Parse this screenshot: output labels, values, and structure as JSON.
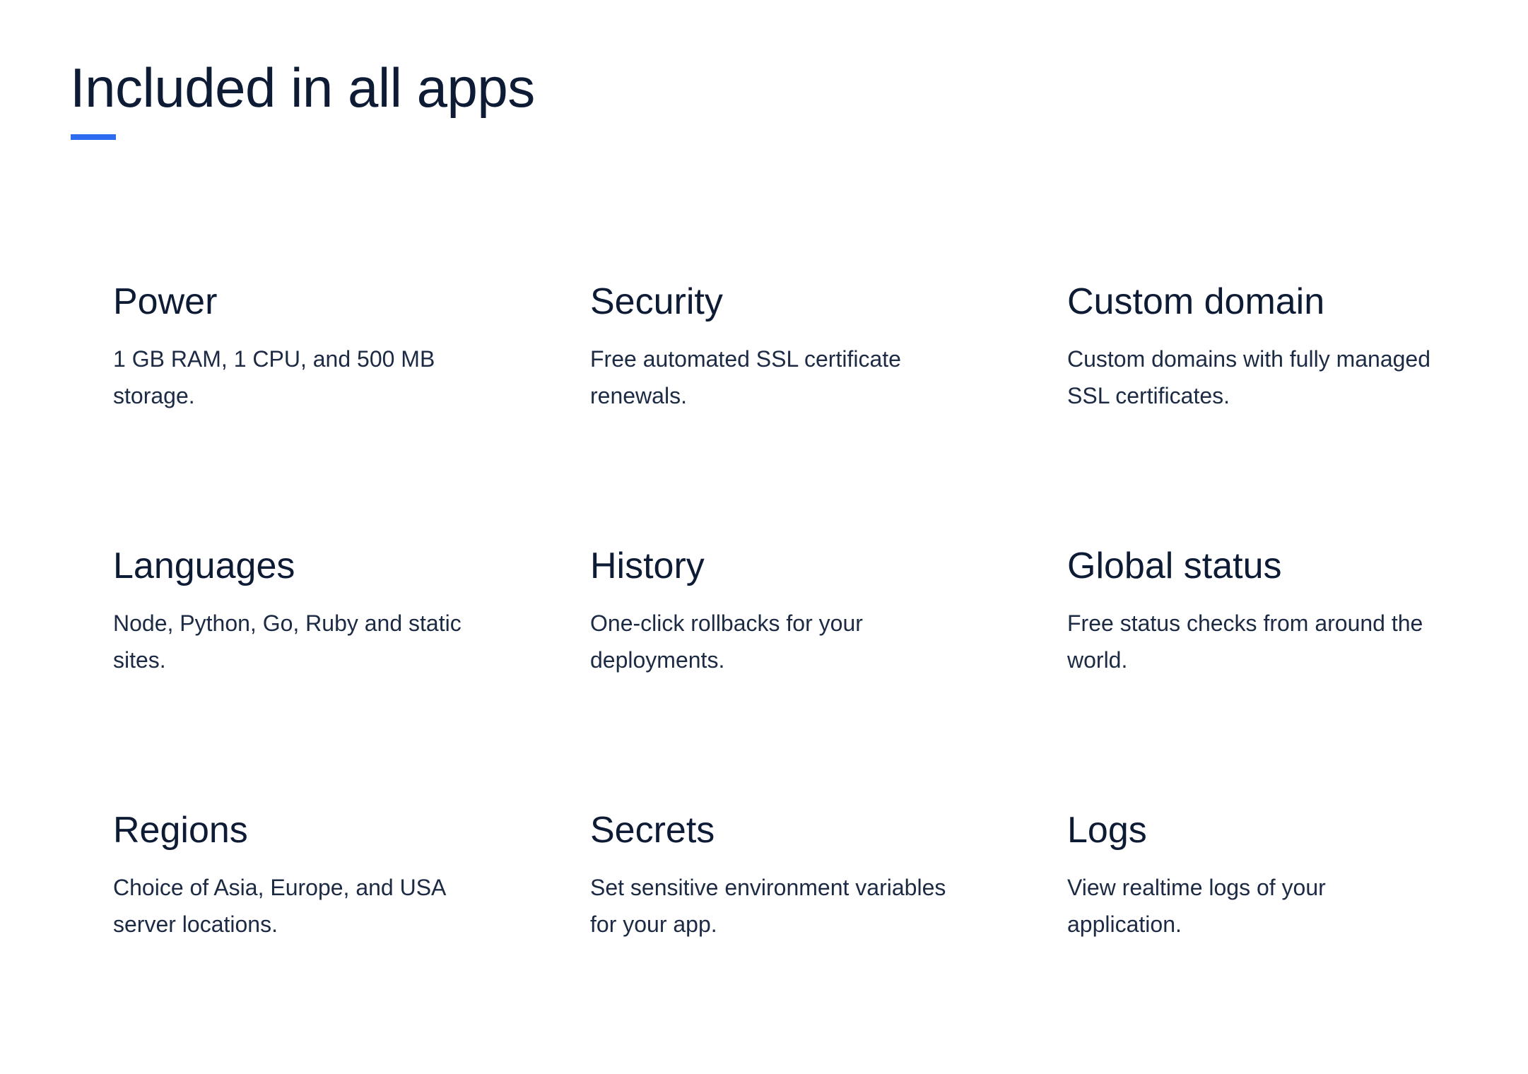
{
  "section": {
    "title": "Included in all apps",
    "accent_color": "#2d6cf0"
  },
  "features": [
    {
      "title": "Power",
      "description": "1 GB RAM, 1 CPU, and 500 MB storage."
    },
    {
      "title": "Security",
      "description": "Free automated SSL certificate renewals."
    },
    {
      "title": "Custom domain",
      "description": "Custom domains with fully managed SSL certificates."
    },
    {
      "title": "Languages",
      "description": "Node, Python, Go, Ruby and static sites."
    },
    {
      "title": "History",
      "description": "One-click rollbacks for your deployments."
    },
    {
      "title": "Global status",
      "description": "Free status checks from around the world."
    },
    {
      "title": "Regions",
      "description": "Choice of Asia, Europe, and USA server locations."
    },
    {
      "title": "Secrets",
      "description": "Set sensitive environment variables for your app."
    },
    {
      "title": "Logs",
      "description": "View realtime logs of your application."
    }
  ]
}
